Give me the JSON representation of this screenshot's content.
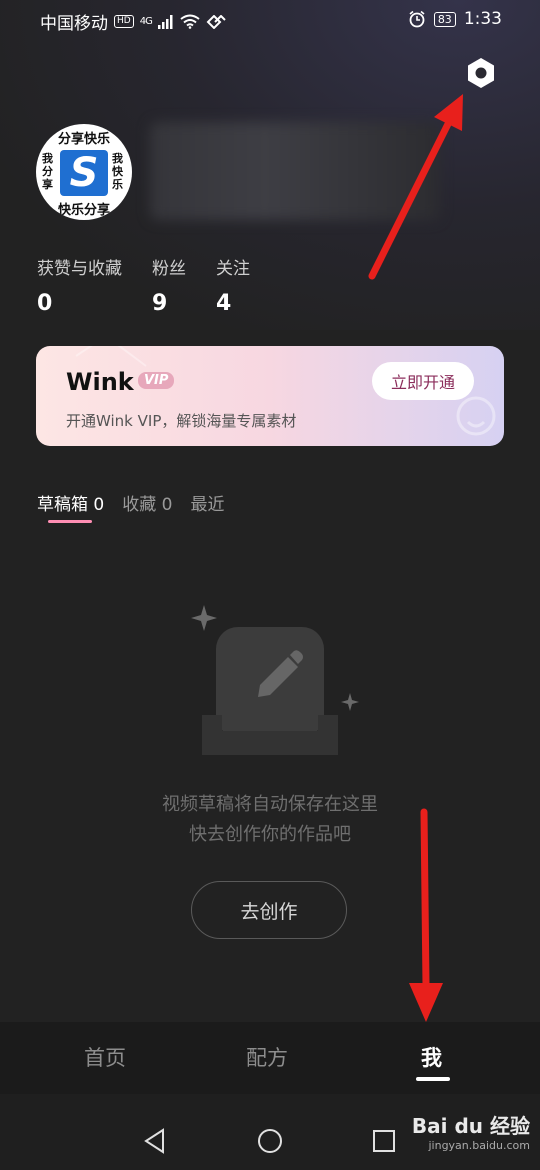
{
  "status_bar": {
    "carrier": "中国移动",
    "hd": "HD",
    "network": "4G",
    "battery": "83",
    "time": "1:33"
  },
  "profile": {
    "avatar_top_text": "分享快乐",
    "avatar_bottom_text": "快乐分享",
    "avatar_left_text": "我分享",
    "avatar_right_text": "我快乐",
    "avatar_logo": "S"
  },
  "stats": [
    {
      "label": "获赞与收藏",
      "value": "0"
    },
    {
      "label": "粉丝",
      "value": "9"
    },
    {
      "label": "关注",
      "value": "4"
    }
  ],
  "vip": {
    "brand": "Wink",
    "badge": "VIP",
    "subtitle": "开通Wink VIP，解锁海量专属素材",
    "button": "立即开通"
  },
  "tabs": [
    {
      "label": "草稿箱 0",
      "active": true
    },
    {
      "label": "收藏 0",
      "active": false
    },
    {
      "label": "最近",
      "active": false
    }
  ],
  "empty_state": {
    "line1": "视频草稿将自动保存在这里",
    "line2": "快去创作你的作品吧",
    "button": "去创作"
  },
  "bottom_nav": [
    {
      "label": "首页",
      "active": false
    },
    {
      "label": "配方",
      "active": false
    },
    {
      "label": "我",
      "active": true
    }
  ],
  "watermark": {
    "line1": "Bai du 经验",
    "line2": "jingyan.baidu.com"
  },
  "colors": {
    "accent_pink": "#ff8fb4",
    "arrow_red": "#e8201c",
    "background": "#222222"
  }
}
